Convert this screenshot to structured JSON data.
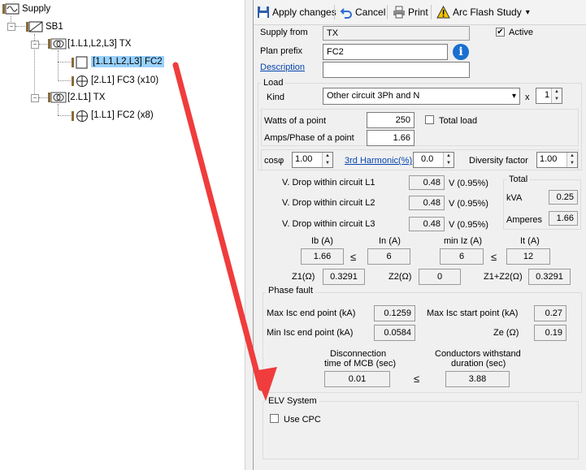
{
  "tree": {
    "supply_label": "Supply",
    "sb1_label": "SB1",
    "tx1_label": "[1.L1,L2,L3] TX",
    "fc2_label": "[1.L1,L2,L3] FC2",
    "fc3_label": "[2.L1] FC3 (x10)",
    "tx2_label": "[2.L1] TX",
    "fc2b_label": "[1.L1] FC2 (x8)",
    "expander_minus": "−"
  },
  "toolbar": {
    "apply_label": "Apply changes",
    "cancel_label": "Cancel",
    "print_label": "Print",
    "arcflash_label": "Arc Flash Study",
    "arcflash_arrow": "▾"
  },
  "header": {
    "supply_from_label": "Supply from",
    "supply_from_value": "TX",
    "active_label": "Active",
    "active_checked": "✔",
    "plan_prefix_label": "Plan prefix",
    "plan_prefix_value": "FC2",
    "info_glyph": "i",
    "description_label": "Description",
    "description_value": ""
  },
  "load": {
    "title": "Load",
    "kind_label": "Kind",
    "kind_value": "Other circuit 3Ph and N",
    "kind_arrow": "▾",
    "x_label": "x",
    "multiplier": "1",
    "watts_label": "Watts of a point",
    "watts_value": "250",
    "total_load_label": "Total load",
    "amps_label": "Amps/Phase of a point",
    "amps_value": "1.66",
    "cos_label": "cosφ",
    "cos_value": "1.00",
    "harmonic_label": "3rd Harmonic(%)",
    "harmonic_value": "0.0",
    "diversity_label": "Diversity factor",
    "diversity_value": "1.00",
    "spin_up": "▲",
    "spin_down": "▼"
  },
  "vdrop": {
    "l1_label": "V. Drop within circuit L1",
    "l1_value": "0.48",
    "l1_pct": "V (0.95%)",
    "l2_label": "V. Drop within circuit L2",
    "l2_value": "0.48",
    "l2_pct": "V (0.95%)",
    "l3_label": "V. Drop within circuit L3",
    "l3_value": "0.48",
    "l3_pct": "V (0.95%)"
  },
  "total": {
    "title": "Total",
    "kva_label": "kVA",
    "kva_value": "0.25",
    "amperes_label": "Amperes",
    "amperes_value": "1.66"
  },
  "currents": {
    "ib_label": "Ib (A)",
    "ib_value": "1.66",
    "le1": "≤",
    "in_label": "In (A)",
    "in_value": "6",
    "miniz_label": "min Iz (A)",
    "miniz_value": "6",
    "le2": "≤",
    "it_label": "It (A)",
    "it_value": "12",
    "z1_label": "Z1(Ω)",
    "z1_value": "0.3291",
    "z2_label": "Z2(Ω)",
    "z2_value": "0",
    "z1z2_label": "Z1+Z2(Ω)",
    "z1z2_value": "0.3291"
  },
  "phase_fault": {
    "title": "Phase fault",
    "max_isc_end_label": "Max Isc end point (kA)",
    "max_isc_end_value": "0.1259",
    "max_isc_start_label": "Max Isc start point (kA)",
    "max_isc_start_value": "0.27",
    "min_isc_end_label": "Min Isc end point (kA)",
    "min_isc_end_value": "0.0584",
    "ze_label": "Ze (Ω)",
    "ze_value": "0.19",
    "disc_label_1": "Disconnection",
    "disc_label_2": "time of MCB (sec)",
    "disc_value": "0.01",
    "le": "≤",
    "withstand_label_1": "Conductors withstand",
    "withstand_label_2": "duration (sec)",
    "withstand_value": "3.88"
  },
  "elv": {
    "title": "ELV System",
    "use_cpc_label": "Use CPC"
  },
  "colors": {
    "arrow": "#f03c3c",
    "selection": "#99d1ff",
    "link": "#0645ad",
    "info": "#1a6fd0"
  }
}
